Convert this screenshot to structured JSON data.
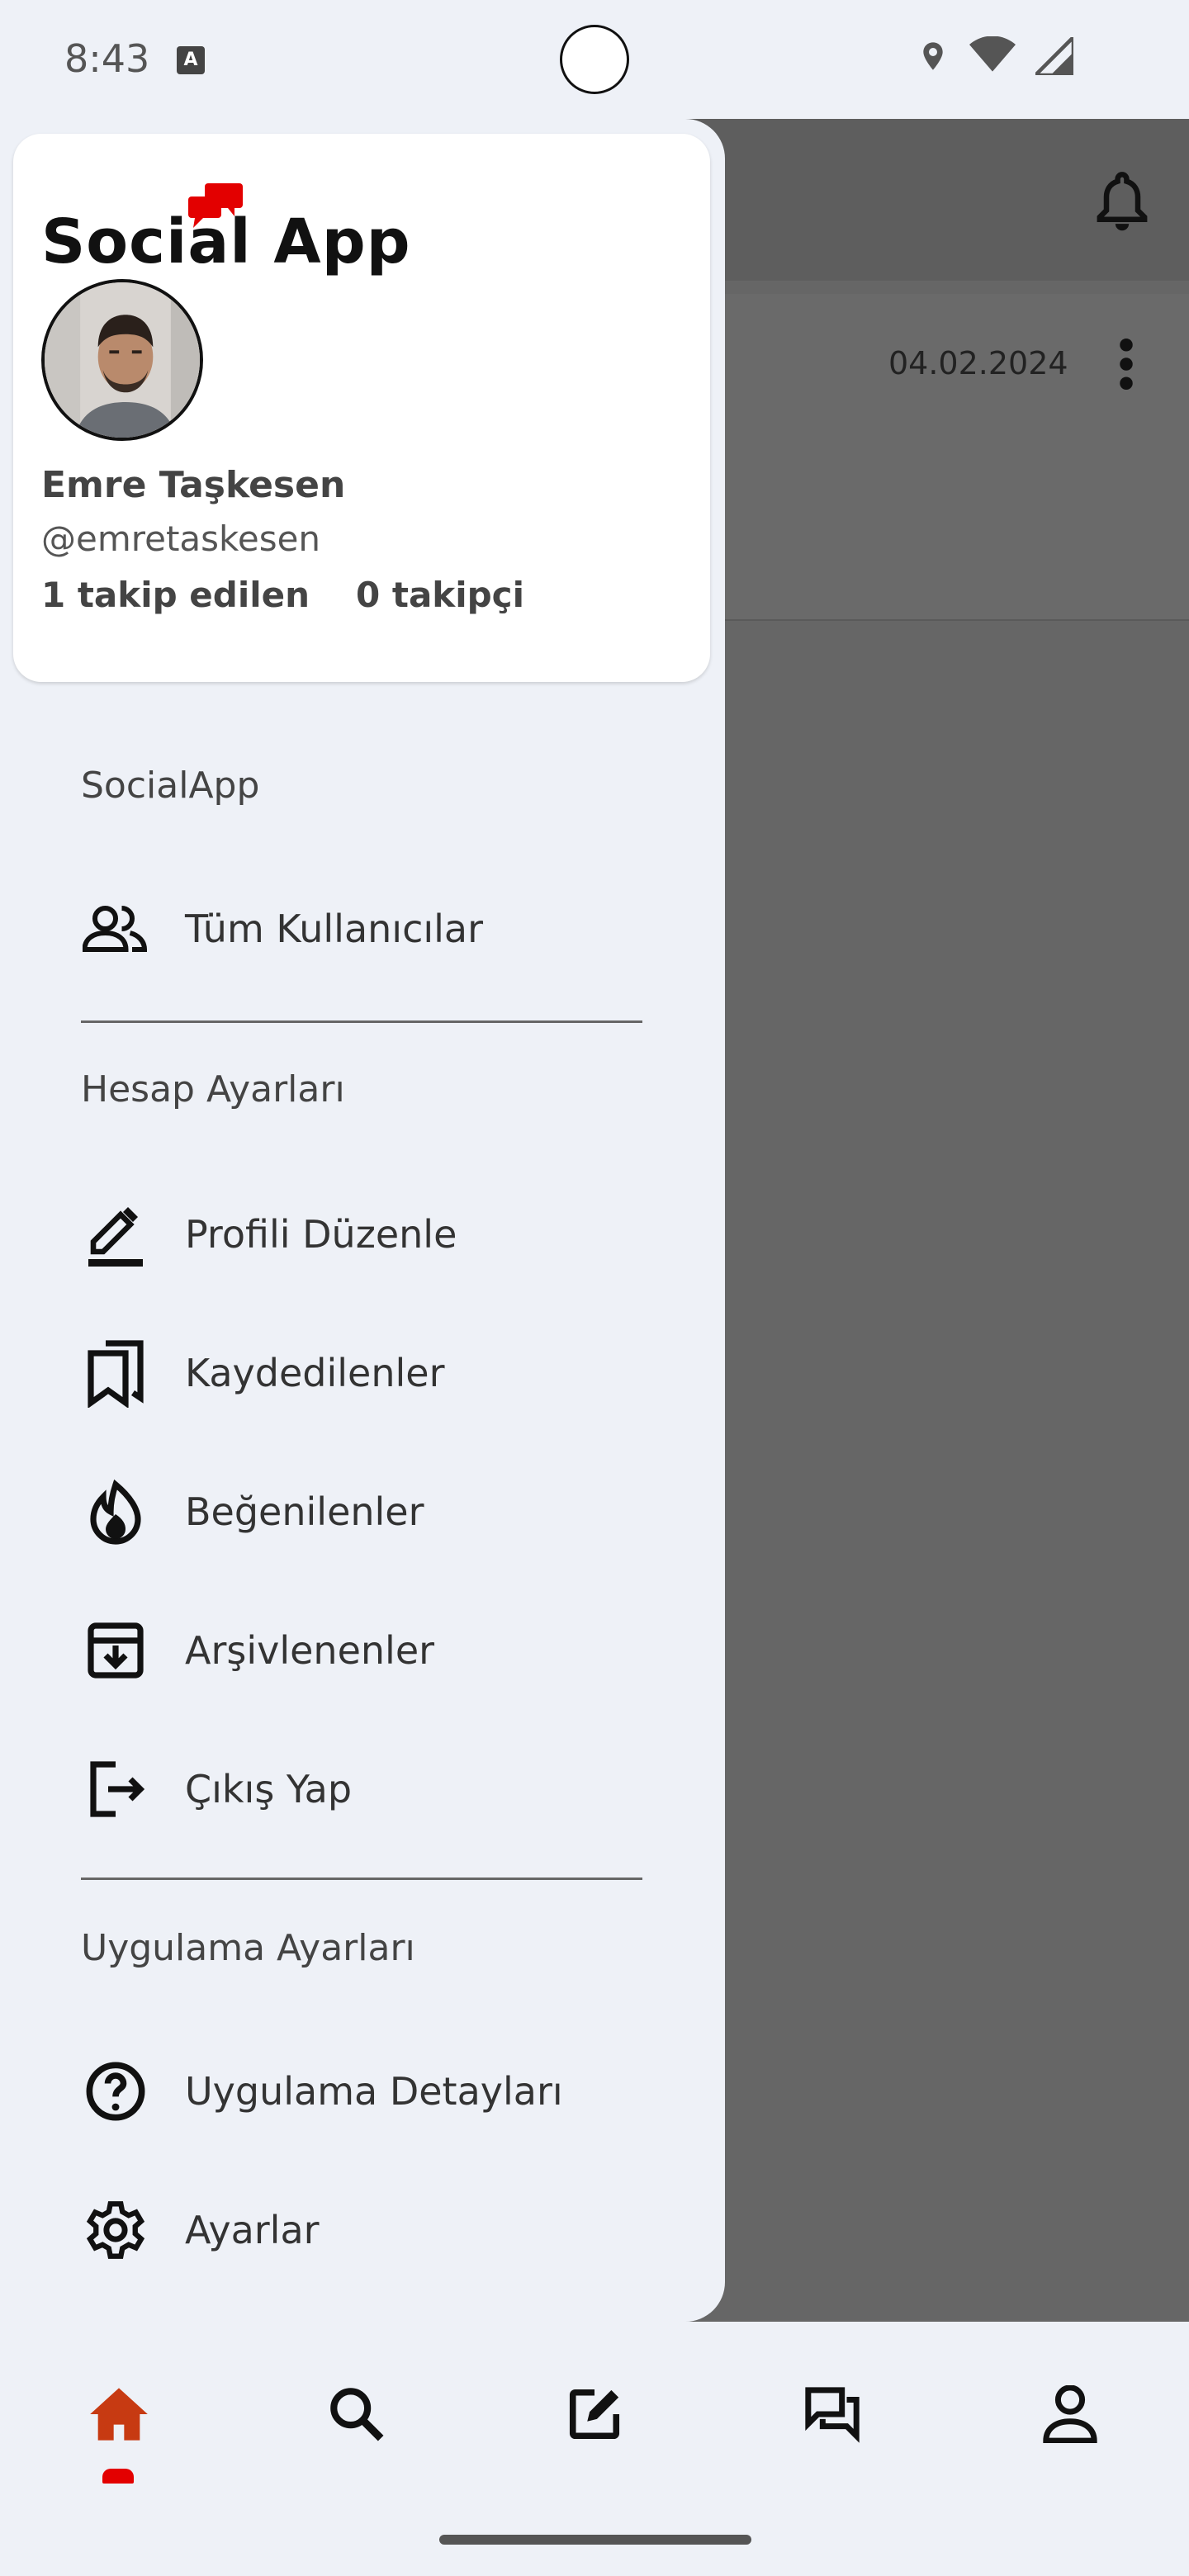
{
  "status_bar": {
    "time": "8:43"
  },
  "background_app": {
    "post_date": "04.02.2024"
  },
  "drawer": {
    "logo_text": "Social App",
    "profile": {
      "name": "Emre Taşkesen",
      "handle": "@emretaskesen",
      "following": "1 takip edilen",
      "followers": "0 takipçi"
    },
    "sections": {
      "app": {
        "title": "SocialApp",
        "items": [
          {
            "label": "Tüm Kullanıcılar",
            "icon": "users-icon"
          }
        ]
      },
      "account": {
        "title": "Hesap Ayarları",
        "items": [
          {
            "label": "Profili Düzenle",
            "icon": "edit-pen-icon"
          },
          {
            "label": "Kaydedilenler",
            "icon": "bookmarks-icon"
          },
          {
            "label": "Beğenilenler",
            "icon": "fire-icon"
          },
          {
            "label": "Arşivlenenler",
            "icon": "archive-icon"
          },
          {
            "label": "Çıkış Yap",
            "icon": "logout-icon"
          }
        ]
      },
      "application": {
        "title": "Uygulama Ayarları",
        "items": [
          {
            "label": "Uygulama Detayları",
            "icon": "help-circle-icon"
          },
          {
            "label": "Ayarlar",
            "icon": "gear-icon"
          }
        ]
      }
    }
  },
  "bottom_nav": {
    "items": [
      "home-icon",
      "search-icon",
      "compose-icon",
      "chat-icon",
      "profile-icon"
    ],
    "active_index": 0,
    "accent_color": "#c73a12",
    "indicator_color": "#e30000"
  }
}
